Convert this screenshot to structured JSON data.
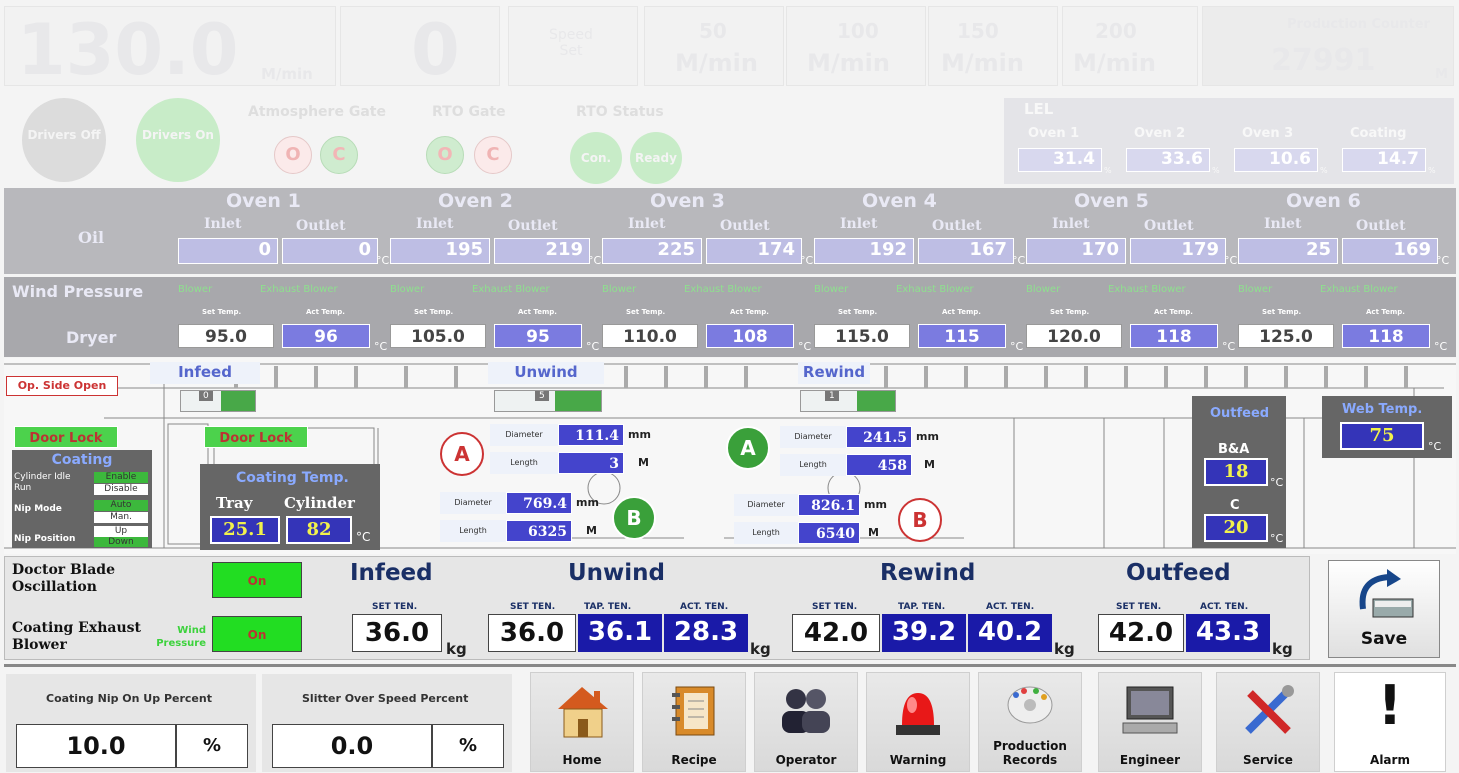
{
  "top": {
    "speed": "130.0",
    "speed_unit": "M/min",
    "zero": "0",
    "speed_set": "Speed\nSet",
    "presets": [
      "50",
      "100",
      "150",
      "200"
    ],
    "preset_unit": "M/min",
    "counter_label": "Production Counter",
    "counter": "27991",
    "counter_unit": "M"
  },
  "status": {
    "drivers_off": "Drivers Off",
    "drivers_on": "Drivers On",
    "atm_gate": "Atmosphere Gate",
    "rto_gate": "RTO Gate",
    "rto_status": "RTO Status",
    "o": "O",
    "c": "C",
    "con": "Con.",
    "ready": "Ready"
  },
  "lel": {
    "title": "LEL",
    "ovens": [
      "Oven 1",
      "Oven 2",
      "Oven 3",
      "Coating"
    ],
    "values": [
      "31.4",
      "33.6",
      "10.6",
      "14.7"
    ],
    "unit": "%"
  },
  "oil": {
    "label": "Oil",
    "ovens": [
      "Oven 1",
      "Oven 2",
      "Oven 3",
      "Oven 4",
      "Oven 5",
      "Oven 6"
    ],
    "inlet": "Inlet",
    "outlet": "Outlet",
    "inlets": [
      "0",
      "195",
      "225",
      "192",
      "170",
      "25"
    ],
    "outlets": [
      "0",
      "219",
      "174",
      "167",
      "179",
      "169"
    ],
    "unit": "°C"
  },
  "dryer": {
    "wind": "Wind Pressure",
    "label": "Dryer",
    "blower": "Blower",
    "exhaust": "Exhaust Blower",
    "set_temp": "Set Temp.",
    "act_temp": "Act Temp.",
    "sets": [
      "95.0",
      "105.0",
      "110.0",
      "115.0",
      "120.0",
      "125.0"
    ],
    "acts": [
      "96",
      "95",
      "108",
      "115",
      "118",
      "118"
    ],
    "unit": "°C"
  },
  "machine": {
    "op_side": "Op. Side Open",
    "infeed": "Infeed",
    "unwind": "Unwind",
    "rewind": "Rewind",
    "infeed_val": "0",
    "unwind_val": "5",
    "rewind_val": "1",
    "door_lock": "Door Lock",
    "door_lock2": "Door Lock",
    "coating": "Coating",
    "cyl_idle": "Cylinder Idle Run",
    "enable": "Enable",
    "disable": "Disable",
    "nip_mode": "Nip Mode",
    "auto": "Auto",
    "man": "Man.",
    "nip_pos": "Nip Position",
    "up": "Up",
    "down": "Down",
    "coating_temp": "Coating Temp.",
    "tray": "Tray",
    "cylinder": "Cylinder",
    "tray_val": "25.1",
    "cyl_val": "82",
    "temp_unit": "°C",
    "diameter": "Diameter",
    "length": "Length",
    "mm": "mm",
    "m": "M",
    "unwind_a_dia": "111.4",
    "unwind_a_len": "3",
    "unwind_b_dia": "769.4",
    "unwind_b_len": "6325",
    "rewind_a_dia": "241.5",
    "rewind_a_len": "458",
    "rewind_b_dia": "826.1",
    "rewind_b_len": "6540",
    "A": "A",
    "B": "B",
    "outfeed": "Outfeed",
    "ba": "B&A",
    "ba_val": "18",
    "c": "C",
    "c_val": "20",
    "web_temp": "Web Temp.",
    "web_val": "75"
  },
  "tension": {
    "doctor": "Doctor Blade Oscillation",
    "coating_exh": "Coating Exhaust Blower",
    "wind": "Wind Pressure",
    "on": "On",
    "infeed": "Infeed",
    "unwind": "Unwind",
    "rewind": "Rewind",
    "outfeed": "Outfeed",
    "set": "SET TEN.",
    "tap": "TAP. TEN.",
    "act": "ACT. TEN.",
    "kg": "kg",
    "infeed_set": "36.0",
    "unwind_set": "36.0",
    "unwind_tap": "36.1",
    "unwind_act": "28.3",
    "rewind_set": "42.0",
    "rewind_tap": "39.2",
    "rewind_act": "40.2",
    "outfeed_set": "42.0",
    "outfeed_act": "43.3",
    "save": "Save"
  },
  "bottom": {
    "nip_pct_label": "Coating Nip On Up Percent",
    "nip_pct": "10.0",
    "slit_label": "Slitter Over Speed Percent",
    "slit_pct": "0.0",
    "pct": "%",
    "nav": [
      "Home",
      "Recipe",
      "Operator",
      "Warning",
      "Production Records",
      "Engineer",
      "Service",
      "Alarm"
    ]
  }
}
